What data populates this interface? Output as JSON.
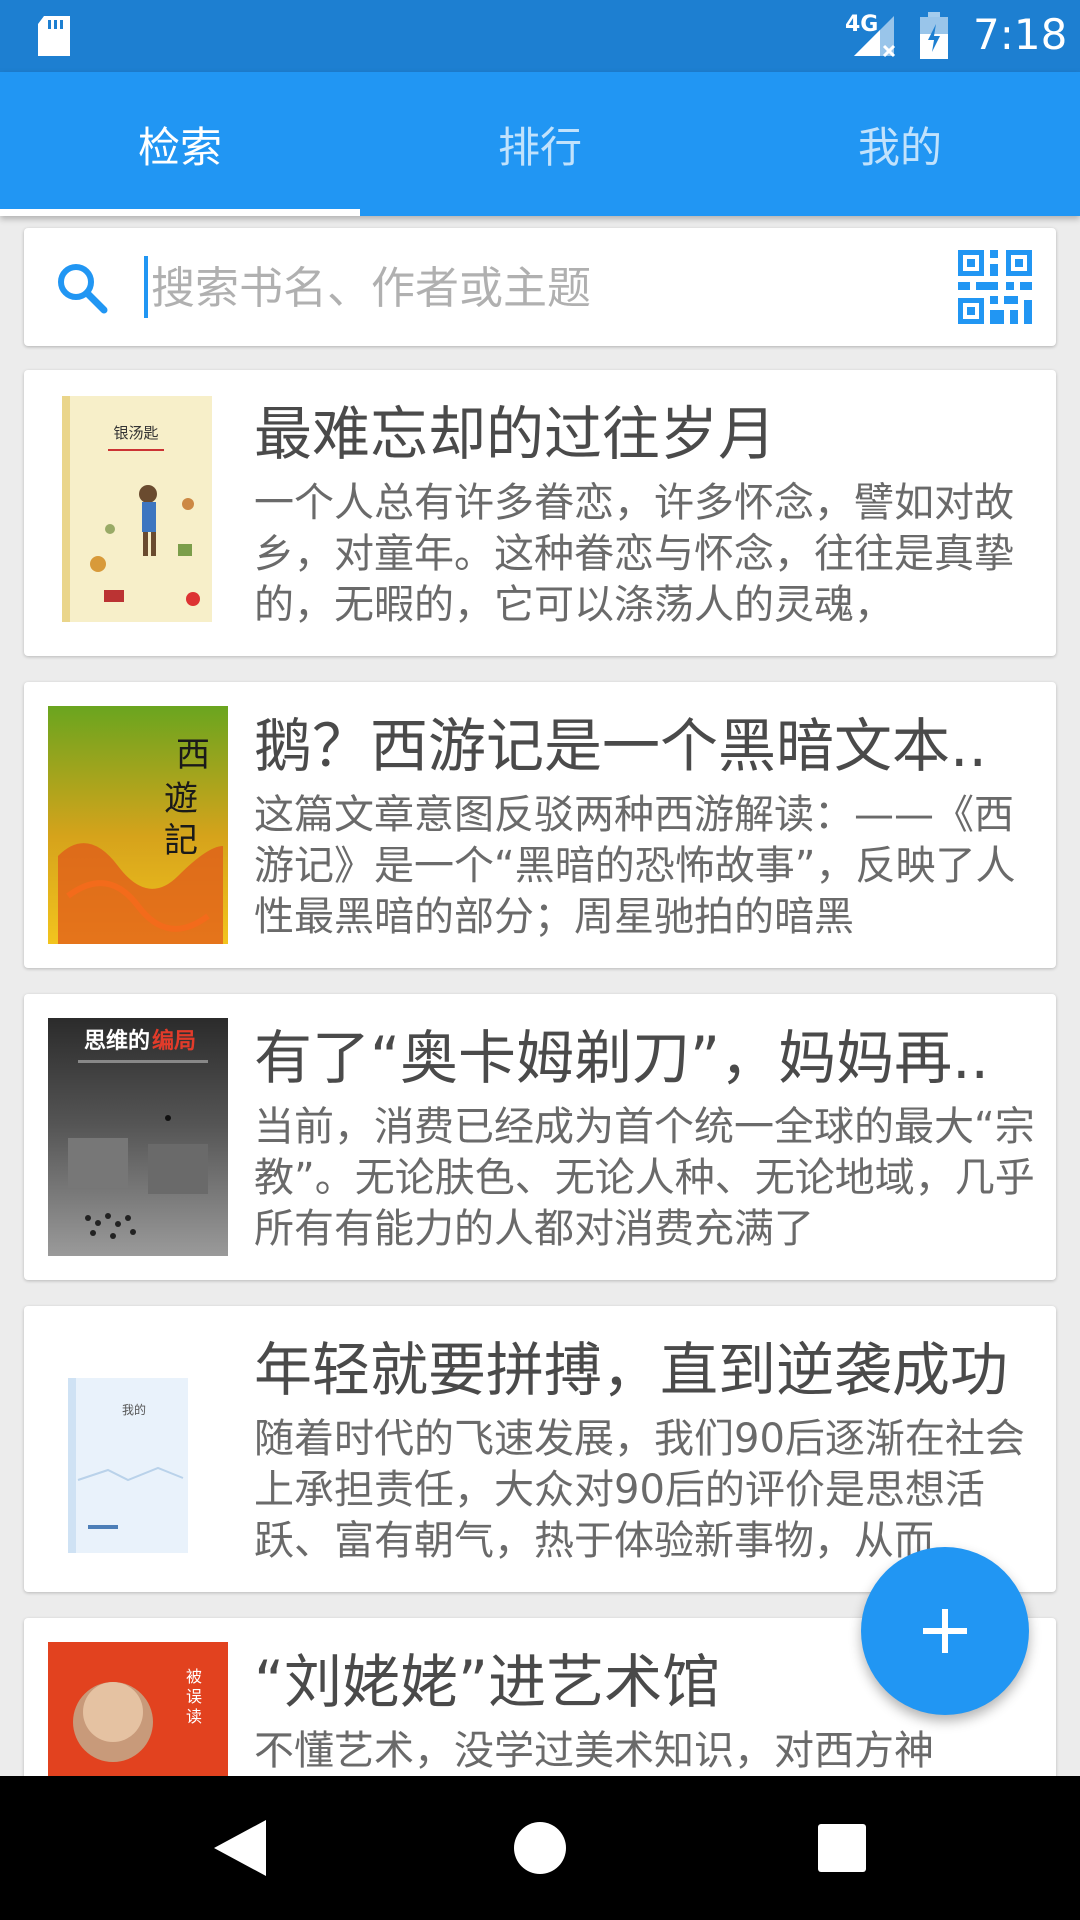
{
  "status_bar": {
    "time": "7:18",
    "network": "4G",
    "icons": [
      "sd-card-icon",
      "signal-icon",
      "battery-icon"
    ]
  },
  "tabs": [
    {
      "label": "检索",
      "active": true
    },
    {
      "label": "排行",
      "active": false
    },
    {
      "label": "我的",
      "active": false
    }
  ],
  "search": {
    "placeholder": "搜索书名、作者或主题",
    "value": "",
    "icons": [
      "search-icon",
      "qr-code-icon"
    ]
  },
  "books": [
    {
      "title": "最难忘却的过往岁月",
      "description": "一个人总有许多眷恋，许多怀念，譬如对故乡，对童年。这种眷恋与怀念，往往是真挚的，无暇的，它可以涤荡人的灵魂，",
      "cover_title": "银汤匙",
      "cover_colors": [
        "#f6eec7",
        "#e8d99a"
      ]
    },
    {
      "title": "鹅？西游记是一个黑暗文本..",
      "description": "这篇文章意图反驳两种西游解读：——《西游记》是一个“黑暗的恐怖故事”，反映了人性最黑暗的部分；周星驰拍的暗黑",
      "cover_title": "西游记",
      "cover_colors": [
        "#8bb52a",
        "#f0a91e"
      ]
    },
    {
      "title": "有了“奥卡姆剃刀”，妈妈再..",
      "description": "当前，消费已经成为首个统一全球的最大“宗教”。无论肤色、无论人种、无论地域，几乎所有有能力的人都对消费充满了",
      "cover_title": "思维的",
      "cover_accent": "编局",
      "cover_colors": [
        "#2d2d2d",
        "#8a8a8a"
      ]
    },
    {
      "title": "年轻就要拼搏，直到逆袭成功",
      "description": "随着时代的飞速发展，我们90后逐渐在社会上承担责任，大众对90后的评价是思想活跃、富有朝气，热于体验新事物，从而",
      "cover_title": "我的",
      "cover_colors": [
        "#eef5fc",
        "#cfe2f4"
      ]
    },
    {
      "title": "“刘姥姥”进艺术馆",
      "description": "不懂艺术，没学过美术知识，对西方神",
      "cover_title": "被误读的艺术史",
      "cover_colors": [
        "#e8411f",
        "#c9301a"
      ]
    }
  ],
  "fab": {
    "icon": "plus-icon"
  },
  "nav_bar": {
    "icons": [
      "back-icon",
      "home-icon",
      "recents-icon"
    ]
  },
  "colors": {
    "primary": "#2196f3",
    "status_bar": "#1d7fd1",
    "background": "#ececec"
  }
}
